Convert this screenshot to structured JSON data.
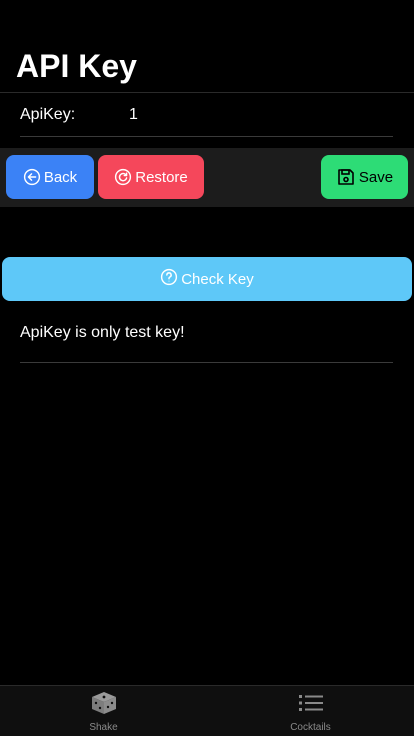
{
  "header": {
    "title": "API Key"
  },
  "apikey": {
    "label": "ApiKey:",
    "value": "1"
  },
  "toolbar": {
    "back_label": "Back",
    "restore_label": "Restore",
    "save_label": "Save"
  },
  "check": {
    "label": "Check Key"
  },
  "info": {
    "text": "ApiKey is only test key!"
  },
  "tabs": [
    {
      "label": "Shake",
      "icon": "dice-icon"
    },
    {
      "label": "Cocktails",
      "icon": "list-icon"
    }
  ],
  "colors": {
    "back": "#3b82f6",
    "restore": "#f5475b",
    "save": "#2ddc76",
    "check": "#5ec8f8"
  }
}
